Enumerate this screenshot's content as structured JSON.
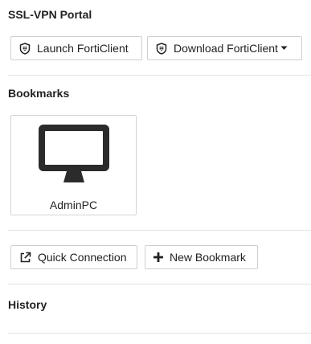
{
  "portal": {
    "title": "SSL-VPN Portal",
    "launch_label": "Launch FortiClient",
    "download_label": "Download FortiClient"
  },
  "bookmarks": {
    "title": "Bookmarks",
    "items": [
      {
        "label": "AdminPC",
        "icon": "monitor-icon"
      }
    ],
    "quick_connection_label": "Quick Connection",
    "new_bookmark_label": "New Bookmark"
  },
  "history": {
    "title": "History"
  }
}
